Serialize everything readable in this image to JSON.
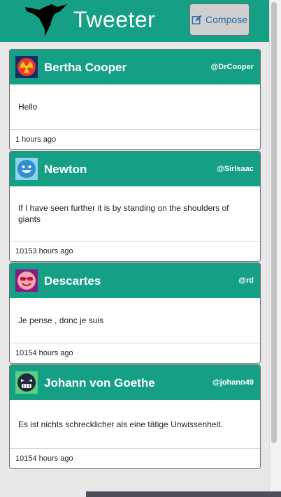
{
  "header": {
    "brand": "Tweeter",
    "compose_label": "Compose",
    "logo_icon": "hummingbird-icon",
    "compose_icon": "edit-icon",
    "accent": "#15a085"
  },
  "tweets": [
    {
      "name": "Bertha Cooper",
      "handle": "@DrCooper",
      "text": "Hello",
      "time": "1 hours ago",
      "avatar_icon": "radioactive-avatar-icon"
    },
    {
      "name": "Newton",
      "handle": "@SirIsaac",
      "text": "If I have seen further it is by standing on the shoulders of giants",
      "time": "10153 hours ago",
      "avatar_icon": "smiley-avatar-icon"
    },
    {
      "name": "Descartes",
      "handle": "@rd",
      "text": "Je pense , donc je suis",
      "time": "10154 hours ago",
      "avatar_icon": "sunglasses-avatar-icon"
    },
    {
      "name": "Johann von Goethe",
      "handle": "@johann49",
      "text": "Es ist nichts schrecklicher als eine tätige Unwissenheit.",
      "time": "10154 hours ago",
      "avatar_icon": "grin-avatar-icon"
    }
  ]
}
